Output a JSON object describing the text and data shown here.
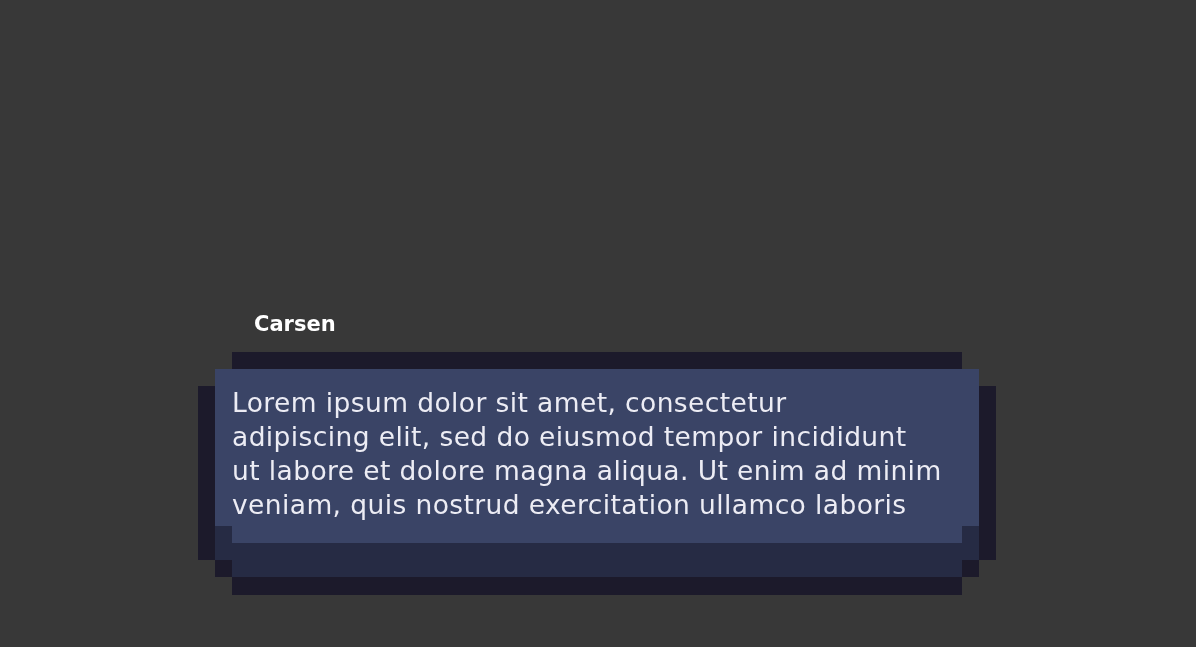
{
  "dialog": {
    "speaker": "Carsen",
    "text": "Lorem ipsum dolor sit amet, consectetur\nadipiscing elit, sed do eiusmod tempor incididunt\nut labore et dolore magna aliqua. Ut enim ad minim\nveniam, quis nostrud exercitation ullamco laboris"
  }
}
